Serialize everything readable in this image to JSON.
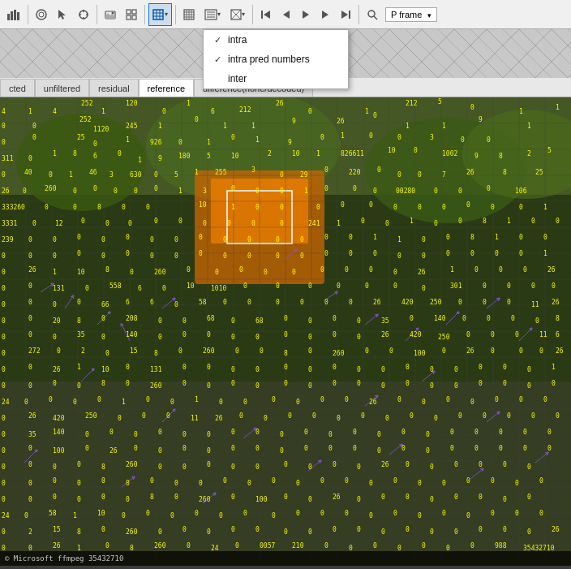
{
  "toolbar": {
    "buttons": [
      {
        "id": "bar-chart",
        "label": "▊",
        "type": "icon"
      },
      {
        "id": "sep1",
        "type": "sep"
      },
      {
        "id": "tool2",
        "label": "▣",
        "type": "icon"
      },
      {
        "id": "sep2",
        "type": "sep"
      },
      {
        "id": "tool3",
        "label": "◎",
        "type": "icon"
      },
      {
        "id": "tool4",
        "label": "⊕",
        "type": "icon"
      },
      {
        "id": "sep3",
        "type": "sep"
      },
      {
        "id": "grid1",
        "label": "⊞",
        "type": "icon-active"
      },
      {
        "id": "grid2",
        "label": "⊟",
        "type": "icon"
      },
      {
        "id": "sep4",
        "type": "sep"
      },
      {
        "id": "grid3",
        "label": "▦",
        "type": "icon"
      },
      {
        "id": "grid4",
        "label": "⋮",
        "type": "icon"
      },
      {
        "id": "grid5",
        "label": "⊠",
        "type": "icon"
      },
      {
        "id": "sep5",
        "type": "sep"
      },
      {
        "id": "prev-key",
        "label": "|◀",
        "type": "icon"
      },
      {
        "id": "prev",
        "label": "◀",
        "type": "icon"
      },
      {
        "id": "play",
        "label": "▶",
        "type": "icon"
      },
      {
        "id": "next",
        "label": "▶",
        "type": "icon"
      },
      {
        "id": "next-key",
        "label": "▶|",
        "type": "icon"
      },
      {
        "id": "sep6",
        "type": "sep"
      },
      {
        "id": "search",
        "label": "🔍",
        "type": "icon"
      }
    ],
    "p_frame_label": "P frame",
    "dropdown_arrow": "▾"
  },
  "dropdown_menu": {
    "items": [
      {
        "id": "intra",
        "label": "intra",
        "checked": true
      },
      {
        "id": "intra-pred",
        "label": "intra pred numbers",
        "checked": true
      },
      {
        "id": "inter",
        "label": "inter",
        "checked": false
      }
    ]
  },
  "tabs": [
    {
      "id": "selected",
      "label": "cted",
      "active": false
    },
    {
      "id": "unfiltered",
      "label": "unfiltered",
      "active": false
    },
    {
      "id": "residual",
      "label": "residual",
      "active": false
    },
    {
      "id": "reference",
      "label": "reference",
      "active": true
    },
    {
      "id": "difference",
      "label": "difference(none/decoded)",
      "active": false
    }
  ],
  "overlay": {
    "numbers_color": "#ffff00",
    "grid_color": "#333333",
    "arrow_color": "#8844ff"
  },
  "status": {
    "text": "© Microsoft  ffmpeg  35432710"
  }
}
